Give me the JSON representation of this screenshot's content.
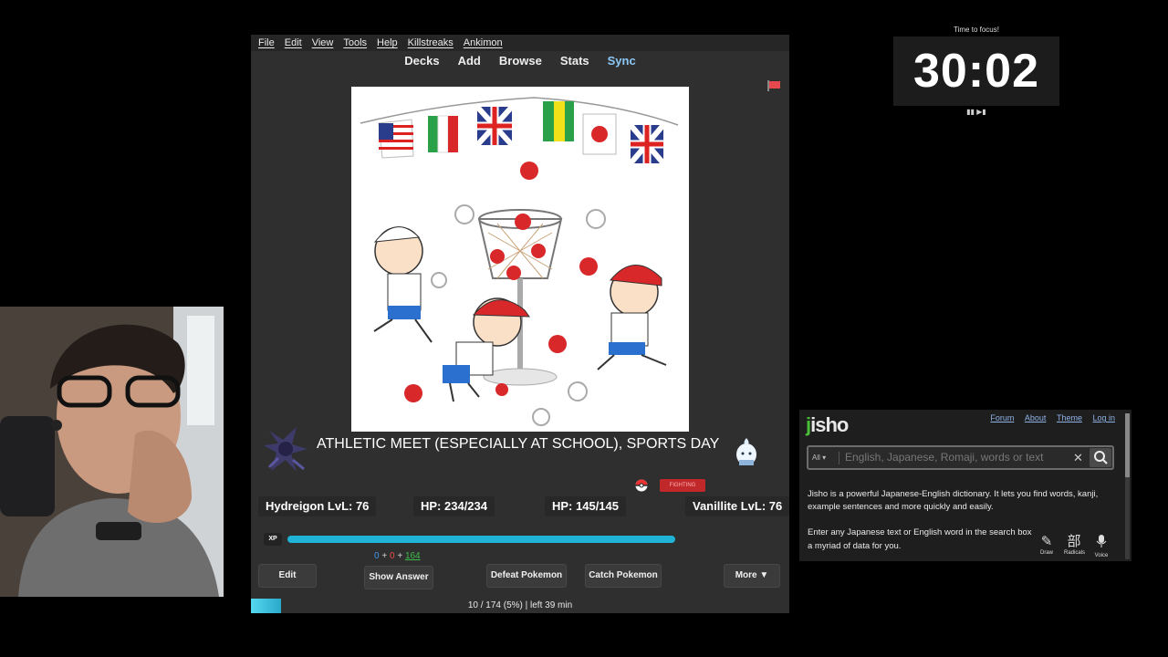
{
  "anki": {
    "menu": [
      "File",
      "Edit",
      "View",
      "Tools",
      "Help",
      "Killstreaks",
      "Ankimon"
    ],
    "toolbar": {
      "decks": "Decks",
      "add": "Add",
      "browse": "Browse",
      "stats": "Stats",
      "sync": "Sync"
    },
    "card": {
      "answer": "ATHLETIC MEET (ESPECIALLY AT SCHOOL), SPORTS DAY"
    },
    "battle": {
      "player_mon": "Hydreigon LvL: 76",
      "player_hp": "HP: 234/234",
      "enemy_hp": "HP: 145/145",
      "enemy_mon": "Vanillite LvL: 76",
      "enemy_type": "FIGHTING",
      "xp_label": "XP",
      "xp_fraction": 1.0
    },
    "counts": {
      "new": "0",
      "plus1": "+",
      "learn": "0",
      "plus2": "+",
      "review": "164"
    },
    "buttons": {
      "edit": "Edit",
      "show_answer": "Show Answer",
      "defeat": "Defeat Pokemon",
      "catch": "Catch Pokemon",
      "more": "More ▼"
    },
    "status": "10 / 174 (5%) | left 39 min"
  },
  "timer": {
    "label": "Time to focus!",
    "time": "30:02",
    "controls": "▮▮ ▶▮"
  },
  "jisho": {
    "logo_j": "j",
    "logo_rest": "isho",
    "links": {
      "forum": "Forum",
      "about": "About",
      "theme": "Theme",
      "login": "Log in"
    },
    "search_scope": "All ▾",
    "search_placeholder": "English, Japanese, Romaji, words or text",
    "clear": "✕",
    "intro1": "Jisho is a powerful Japanese-English dictionary. It lets you find words, kanji, example sentences and more quickly and easily.",
    "intro2": "Enter any Japanese text or English word in the search box",
    "intro2b": "a myriad of data for you.",
    "tools": {
      "draw": "Draw",
      "radicals": "Radicals",
      "voice": "Voice",
      "radicals_glyph": "部"
    }
  }
}
